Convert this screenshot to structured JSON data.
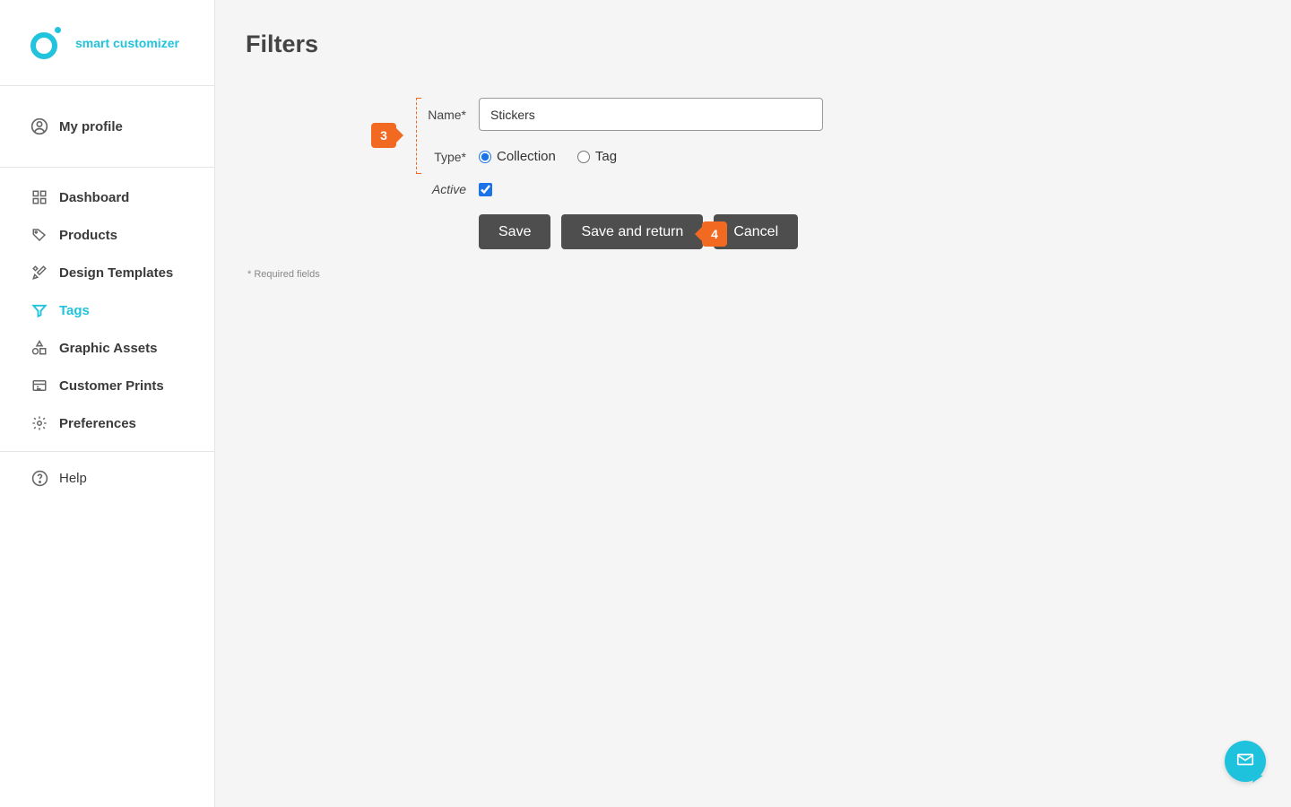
{
  "brand": {
    "name": "smart customizer"
  },
  "sidebar": {
    "profile_label": "My profile",
    "items": [
      {
        "label": "Dashboard"
      },
      {
        "label": "Products"
      },
      {
        "label": "Design Templates"
      },
      {
        "label": "Tags"
      },
      {
        "label": "Graphic Assets"
      },
      {
        "label": "Customer Prints"
      },
      {
        "label": "Preferences"
      }
    ],
    "help_label": "Help"
  },
  "page": {
    "title": "Filters",
    "required_note": "* Required fields"
  },
  "callouts": {
    "step3": "3",
    "step4": "4"
  },
  "form": {
    "name_label": "Name*",
    "name_value": "Stickers",
    "type_label": "Type*",
    "type_option_collection": "Collection",
    "type_option_tag": "Tag",
    "type_selected": "collection",
    "active_label": "Active",
    "active_checked": true
  },
  "buttons": {
    "save": "Save",
    "save_return": "Save and return",
    "cancel": "Cancel"
  }
}
